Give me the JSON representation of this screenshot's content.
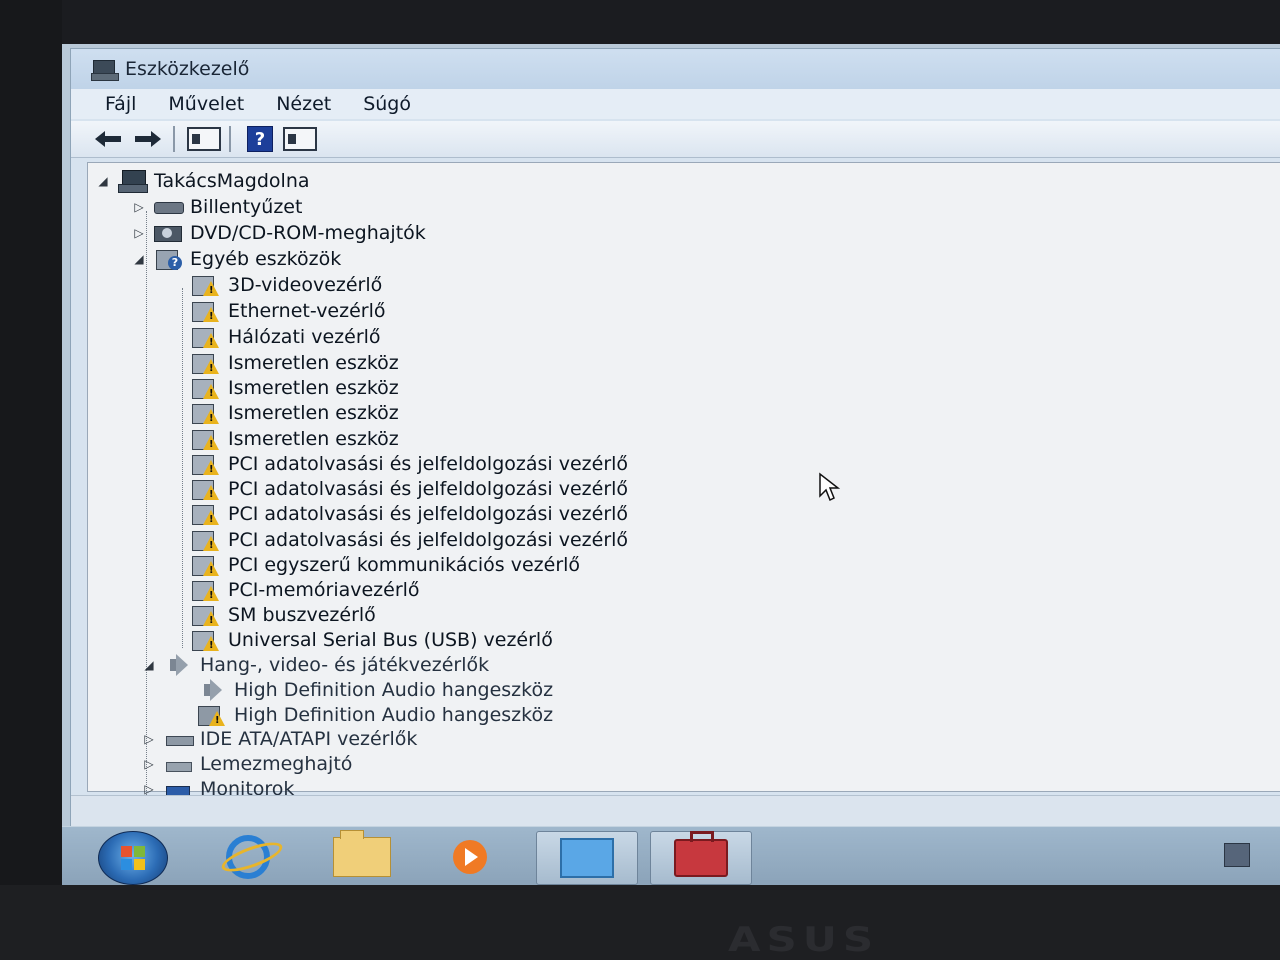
{
  "window": {
    "title": "Eszközkezelő"
  },
  "menu": [
    "Fájl",
    "Művelet",
    "Nézet",
    "Súgó"
  ],
  "toolbar": {
    "buttons": [
      "back-icon",
      "forward-icon",
      "show-hide-console-tree-icon",
      "help-icon",
      "properties-icon"
    ]
  },
  "tree": {
    "root": "TakácsMagdolna",
    "rows": [
      {
        "label": "Billentyűzet",
        "icon": "keyboard-icon",
        "state": "collapsed"
      },
      {
        "label": "DVD/CD-ROM-meghajtók",
        "icon": "dvd-drive-icon",
        "state": "collapsed"
      },
      {
        "label": "Egyéb eszközök",
        "icon": "other-devices-icon",
        "state": "expanded"
      },
      {
        "label": "3D-videovezérlő",
        "icon": "warning-device-icon"
      },
      {
        "label": "Ethernet-vezérlő",
        "icon": "warning-device-icon"
      },
      {
        "label": "Hálózati vezérlő",
        "icon": "warning-device-icon"
      },
      {
        "label": "Ismeretlen eszköz",
        "icon": "warning-device-icon"
      },
      {
        "label": "Ismeretlen eszköz",
        "icon": "warning-device-icon"
      },
      {
        "label": "Ismeretlen eszköz",
        "icon": "warning-device-icon"
      },
      {
        "label": "Ismeretlen eszköz",
        "icon": "warning-device-icon"
      },
      {
        "label": "PCI adatolvasási és jelfeldolgozási vezérlő",
        "icon": "warning-device-icon"
      },
      {
        "label": "PCI adatolvasási és jelfeldolgozási vezérlő",
        "icon": "warning-device-icon"
      },
      {
        "label": "PCI adatolvasási és jelfeldolgozási vezérlő",
        "icon": "warning-device-icon"
      },
      {
        "label": "PCI adatolvasási és jelfeldolgozási vezérlő",
        "icon": "warning-device-icon"
      },
      {
        "label": "PCI egyszerű kommunikációs vezérlő",
        "icon": "warning-device-icon"
      },
      {
        "label": "PCI-memóriavezérlő",
        "icon": "warning-device-icon"
      },
      {
        "label": "SM buszvezérlő",
        "icon": "warning-device-icon"
      },
      {
        "label": "Universal Serial Bus (USB) vezérlő",
        "icon": "warning-device-icon"
      },
      {
        "label": "Hang-, video- és játékvezérlők",
        "icon": "sound-icon",
        "state": "expanded"
      },
      {
        "label": "High Definition Audio hangeszköz",
        "icon": "speaker-icon"
      },
      {
        "label": "High Definition Audio hangeszköz",
        "icon": "speaker-warning-icon"
      },
      {
        "label": "IDE ATA/ATAPI vezérlők",
        "icon": "ide-controller-icon",
        "state": "collapsed"
      },
      {
        "label": "Lemezmeghajtó",
        "icon": "disk-drive-icon",
        "state": "collapsed"
      },
      {
        "label": "Monitorok",
        "icon": "monitor-icon",
        "state": "collapsed"
      }
    ]
  },
  "taskbar": {
    "apps": [
      "internet-explorer-icon",
      "explorer-folder-icon",
      "media-player-icon",
      "device-manager-icon",
      "toolbox-icon"
    ]
  },
  "brand": "ASUS"
}
